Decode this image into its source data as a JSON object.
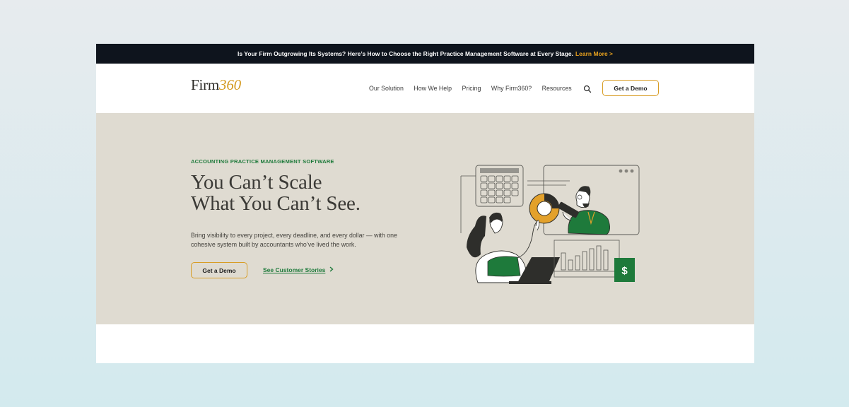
{
  "announcement": {
    "text": "Is Your Firm Outgrowing Its Systems? Here’s How to Choose the Right Practice Management Software at Every Stage.",
    "link_label": "Learn More >"
  },
  "nav": {
    "logo_main": "Firm",
    "logo_accent": "360",
    "items": [
      {
        "label": "Our Solution"
      },
      {
        "label": "How We Help"
      },
      {
        "label": "Pricing"
      },
      {
        "label": "Why Firm360?"
      },
      {
        "label": "Resources"
      }
    ],
    "search_icon": "search-icon",
    "cta_label": "Get a Demo"
  },
  "hero": {
    "eyebrow": "ACCOUNTING PRACTICE MANAGEMENT SOFTWARE",
    "headline_line1": "You Can’t Scale",
    "headline_line2": "What You Can’t See.",
    "subtext": "Bring visibility to every project, every deadline, and every dollar — with one cohesive system built by accountants who’ve lived the work.",
    "primary_cta": "Get a Demo",
    "secondary_cta": "See Customer Stories",
    "secondary_cta_icon": "chevron-right-icon",
    "illustration_badge": "$"
  },
  "colors": {
    "announcement_bg": "#0e141d",
    "accent_gold": "#d89d25",
    "brand_green": "#1e7a3b",
    "hero_bg": "#dfdbd1"
  }
}
